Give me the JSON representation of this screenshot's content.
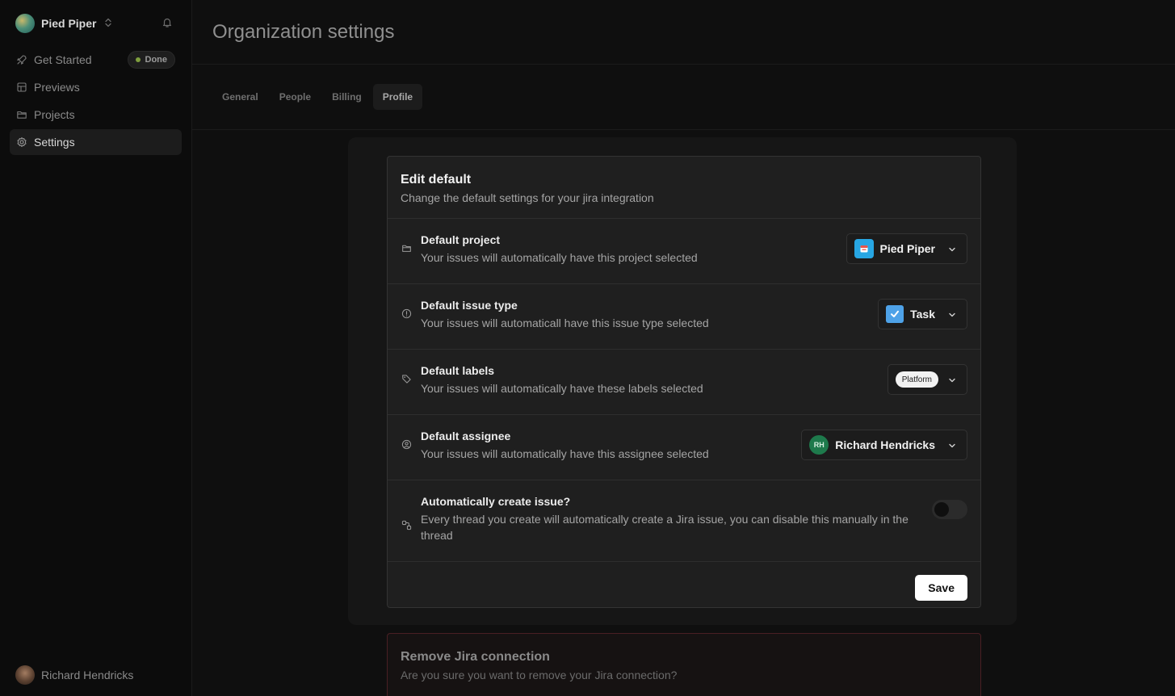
{
  "sidebar": {
    "org_name": "Pied Piper",
    "items": [
      {
        "label": "Get Started",
        "icon": "rocket-icon",
        "badge": "Done"
      },
      {
        "label": "Previews",
        "icon": "layout-icon"
      },
      {
        "label": "Projects",
        "icon": "folder-icon"
      },
      {
        "label": "Settings",
        "icon": "gear-icon",
        "active": true
      }
    ],
    "user_name": "Richard Hendricks"
  },
  "header": {
    "title": "Organization settings"
  },
  "tabs": [
    {
      "label": "General"
    },
    {
      "label": "People"
    },
    {
      "label": "Billing"
    },
    {
      "label": "Profile",
      "active": true
    }
  ],
  "edit_default": {
    "title": "Edit default",
    "subtitle": "Change the default settings for your jira integration",
    "rows": [
      {
        "title": "Default project",
        "desc": "Your issues will automatically have this project selected",
        "value": "Pied Piper"
      },
      {
        "title": "Default issue type",
        "desc": "Your issues will automaticall have this issue type selected",
        "value": "Task"
      },
      {
        "title": "Default labels",
        "desc": "Your issues will automatically have these labels selected",
        "value": "Platform"
      },
      {
        "title": "Default assignee",
        "desc": "Your issues will automatically have this assignee selected",
        "value": "Richard Hendricks",
        "initials": "RH"
      },
      {
        "title": "Automatically create issue?",
        "desc": "Every thread you create will automatically create a Jira issue, you can disable this manually in the thread",
        "toggle_on": false
      }
    ],
    "save_label": "Save"
  },
  "remove_jira": {
    "title": "Remove Jira connection",
    "subtitle": "Are you sure you want to remove your Jira connection?"
  },
  "colors": {
    "accent_done": "#7f9f3e",
    "project_icon": "#27a6e3",
    "task_icon": "#4ea2e8",
    "assignee_avatar": "#1e7a4c",
    "danger_border": "#4a1f24"
  }
}
